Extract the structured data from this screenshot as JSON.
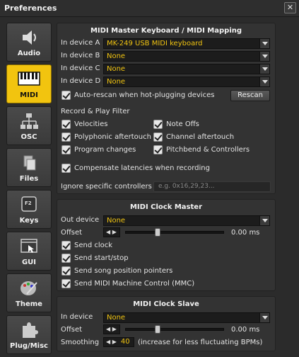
{
  "window": {
    "title": "Preferences",
    "close_glyph": "✕"
  },
  "sidebar": {
    "items": [
      {
        "label": "Audio",
        "icon": "speaker-icon"
      },
      {
        "label": "MIDI",
        "icon": "midi-keyboard-icon",
        "active": true
      },
      {
        "label": "OSC",
        "icon": "network-icon"
      },
      {
        "label": "Files",
        "icon": "files-icon"
      },
      {
        "label": "Keys",
        "icon": "keys-icon"
      },
      {
        "label": "GUI",
        "icon": "gui-icon"
      },
      {
        "label": "Theme",
        "icon": "palette-icon"
      },
      {
        "label": "Plug/Misc",
        "icon": "puzzle-icon"
      }
    ]
  },
  "midi_mapping": {
    "title": "MIDI Master Keyboard / MIDI Mapping",
    "devices": [
      {
        "label": "In device A",
        "value": "MK-249 USB MIDI keyboard"
      },
      {
        "label": "In device B",
        "value": "None"
      },
      {
        "label": "In device C",
        "value": "None"
      },
      {
        "label": "In device D",
        "value": "None"
      }
    ],
    "auto_rescan_label": "Auto-rescan when hot-plugging devices",
    "rescan_button": "Rescan",
    "filter_title": "Record & Play Filter",
    "filters": [
      {
        "label": "Velocities",
        "checked": true
      },
      {
        "label": "Note Offs",
        "checked": true
      },
      {
        "label": "Polyphonic aftertouch",
        "checked": true
      },
      {
        "label": "Channel aftertouch",
        "checked": true
      },
      {
        "label": "Program changes",
        "checked": true
      },
      {
        "label": "Pitchbend & Controllers",
        "checked": true
      }
    ],
    "compensate_label": "Compensate latencies when recording",
    "ignore_label": "Ignore specific controllers",
    "ignore_placeholder": "e.g. 0x16,29,23..."
  },
  "clock_master": {
    "title": "MIDI Clock Master",
    "out_device_label": "Out device",
    "out_device_value": "None",
    "offset_label": "Offset",
    "spin_arrows": "◀ ▶",
    "offset_value": "0.00 ms",
    "offset_fraction": 0.33,
    "checks": [
      {
        "label": "Send clock",
        "checked": true
      },
      {
        "label": "Send start/stop",
        "checked": true
      },
      {
        "label": "Send song position pointers",
        "checked": true
      },
      {
        "label": "Send MIDI Machine Control (MMC)",
        "checked": true
      }
    ]
  },
  "clock_slave": {
    "title": "MIDI Clock Slave",
    "in_device_label": "In device",
    "in_device_value": "None",
    "offset_label": "Offset",
    "spin_arrows": "◀ ▶",
    "offset_value": "0.00 ms",
    "offset_fraction": 0.33,
    "smoothing_label": "Smoothing",
    "smoothing_value": "40",
    "smoothing_hint": "(increase for less fluctuating BPMs)"
  },
  "colors": {
    "accent": "#f2c40f",
    "value_text": "#f1c411"
  }
}
